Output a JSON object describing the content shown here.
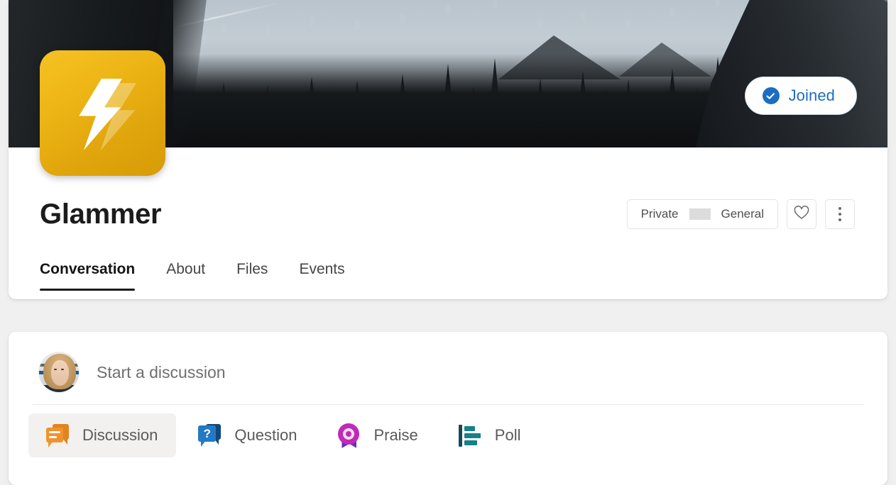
{
  "group": {
    "name": "Glammer",
    "logo_icon": "lightning-bolt-icon",
    "cover_alt": "snowy-forest-cover-photo",
    "join_button": {
      "label": "Joined",
      "icon": "check-circle-icon",
      "accent_color": "#1b6ec2"
    },
    "privacy": "Private",
    "category": "General",
    "favorite_icon": "heart-outline-icon",
    "more_icon": "more-vertical-icon"
  },
  "tabs": [
    {
      "label": "Conversation",
      "active": true
    },
    {
      "label": "About",
      "active": false
    },
    {
      "label": "Files",
      "active": false
    },
    {
      "label": "Events",
      "active": false
    }
  ],
  "composer": {
    "avatar_name": "user-avatar",
    "placeholder": "Start a discussion",
    "post_types": [
      {
        "label": "Discussion",
        "icon": "discussion-icon",
        "selected": true
      },
      {
        "label": "Question",
        "icon": "question-icon",
        "selected": false
      },
      {
        "label": "Praise",
        "icon": "praise-icon",
        "selected": false
      },
      {
        "label": "Poll",
        "icon": "poll-icon",
        "selected": false
      }
    ]
  },
  "colors": {
    "brand_yellow": "#eeb616",
    "link_blue": "#1b6ec2",
    "page_bg": "#f0f0f0",
    "discussion_orange": "#f2922d",
    "question_blue": "#2479c4",
    "praise_magenta": "#c02ab8",
    "poll_teal": "#17808c"
  }
}
